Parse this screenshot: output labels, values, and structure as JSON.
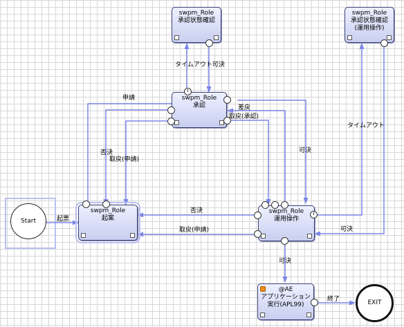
{
  "nodes": {
    "kigian": {
      "role": "swpm_Role",
      "name": "起案"
    },
    "shonin": {
      "role": "swpm_Role",
      "name": "承認"
    },
    "shonin_jotai": {
      "role": "swpm_Role",
      "name": "承認状態確認"
    },
    "unyo": {
      "role": "swpm_Role",
      "name": "運用操作"
    },
    "unyo_jotai": {
      "role": "swpm_Role",
      "name": "承認状態確認(運用操作)"
    },
    "app": {
      "role": "@AE",
      "name": "アプリケーション実行(APL99)"
    }
  },
  "terminals": {
    "start": "Start",
    "exit": "EXIT"
  },
  "edges": {
    "kihyo": "起票",
    "shinsei": "申請",
    "hiketsu_left": "否決",
    "torimodoshi_shinsei_left": "取戻(申請)",
    "timeout_kaketsu": "タイムアウト可決",
    "sashimodoshi": "差戻",
    "torimodoshi_shonin": "取戻(承認)",
    "kaketsu_right": "可決",
    "timeout_right": "タイムアウト",
    "hiketsu_mid": "否決",
    "torimodoshi_shinsei_mid": "取戻(申請)",
    "kaketsu_in": "可決",
    "kaketsu_down": "可決",
    "shuryo": "終了"
  },
  "colors": {
    "connector": "#7b86e8",
    "node_border": "#3a3f73",
    "grid": "#d6d6d6",
    "app_badge": "#f28c1c"
  }
}
